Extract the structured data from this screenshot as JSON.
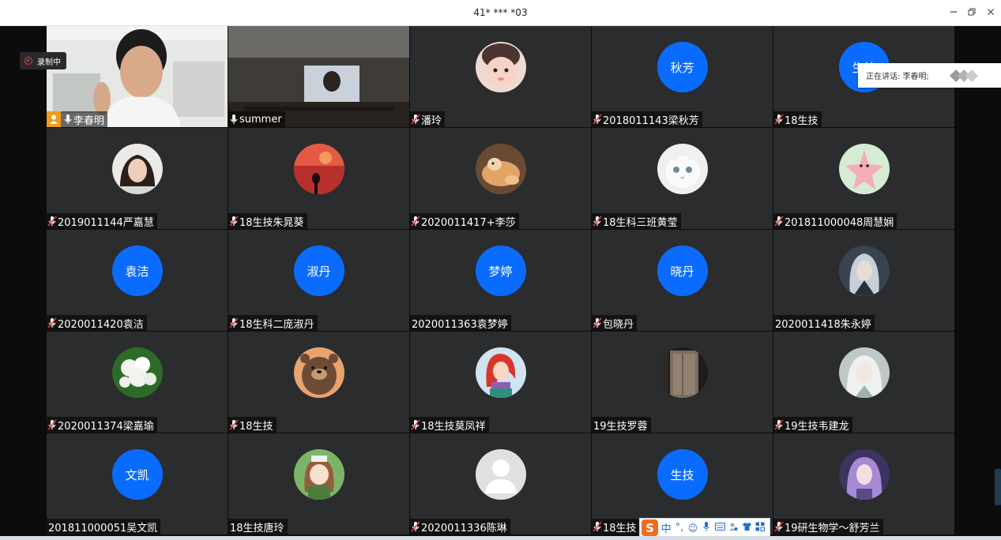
{
  "window": {
    "title": "41* *** *03",
    "buttons": [
      "minimize",
      "restore",
      "close"
    ]
  },
  "recording": {
    "label": "录制中",
    "icon": "record-icon"
  },
  "speaking": {
    "label": "正在讲话: 李春明;"
  },
  "colors": {
    "avatar_blue": "#0a6cff",
    "tile_bg": "#2b2c2e",
    "active_border": "#35c46b",
    "host_badge": "#f29a1a",
    "recording_red": "#e2403b"
  },
  "participants": [
    {
      "name": "李春明",
      "muted": false,
      "host": true,
      "kind": "video",
      "scene": "person",
      "active": true
    },
    {
      "name": "summer",
      "muted": false,
      "kind": "video",
      "scene": "classroom"
    },
    {
      "name": "潘玲",
      "muted": true,
      "kind": "photo",
      "scene": "baby"
    },
    {
      "name": "2018011143梁秋芳",
      "muted": true,
      "kind": "text",
      "avatar_text": "秋芳"
    },
    {
      "name": "18生技",
      "muted": true,
      "kind": "text",
      "avatar_text": "生技"
    },
    {
      "name": "2019011144严嘉慧",
      "muted": true,
      "kind": "photo",
      "scene": "girl"
    },
    {
      "name": "18生技朱晁葵",
      "muted": true,
      "kind": "photo",
      "scene": "sunset"
    },
    {
      "name": "2020011417+李莎",
      "muted": true,
      "kind": "photo",
      "scene": "dog"
    },
    {
      "name": "18生科三班黄莹",
      "muted": true,
      "kind": "photo",
      "scene": "cat"
    },
    {
      "name": "201811000048周慧娴",
      "muted": true,
      "kind": "photo",
      "scene": "starfish"
    },
    {
      "name": "2020011420袁洁",
      "muted": true,
      "kind": "text",
      "avatar_text": "袁洁"
    },
    {
      "name": "18生科二庞淑丹",
      "muted": true,
      "kind": "text",
      "avatar_text": "淑丹"
    },
    {
      "name": "2020011363袁梦婷",
      "muted": false,
      "kind": "text",
      "avatar_text": "梦婷",
      "no_mic": true
    },
    {
      "name": "包晓丹",
      "muted": true,
      "kind": "text",
      "avatar_text": "晓丹"
    },
    {
      "name": "2020011418朱永婷",
      "muted": false,
      "kind": "photo",
      "scene": "anime-silver",
      "no_mic": true
    },
    {
      "name": "2020011374梁嘉瑜",
      "muted": true,
      "kind": "photo",
      "scene": "flowers"
    },
    {
      "name": "18生技",
      "muted": true,
      "kind": "photo",
      "scene": "bear"
    },
    {
      "name": "18生技莫凤祥",
      "muted": true,
      "kind": "photo",
      "scene": "mermaid"
    },
    {
      "name": "19生技罗蓉",
      "muted": false,
      "kind": "photo",
      "scene": "door",
      "no_mic": true
    },
    {
      "name": "19生技韦建龙",
      "muted": true,
      "kind": "photo",
      "scene": "anime-white"
    },
    {
      "name": "文凯",
      "muted": false,
      "kind": "text",
      "avatar_text": "文凯",
      "label": "201811000051吴文凯",
      "no_mic": true
    },
    {
      "name": "18生技唐玲",
      "muted": false,
      "kind": "photo",
      "scene": "anime-girl",
      "no_mic": true
    },
    {
      "name": "2020011336陈琳",
      "muted": true,
      "kind": "photo",
      "scene": "default"
    },
    {
      "name": "18生技",
      "muted": true,
      "kind": "text",
      "avatar_text": "生技"
    },
    {
      "name": "19研生物学～舒芳兰",
      "muted": true,
      "kind": "photo",
      "scene": "anime-purple"
    }
  ],
  "ime": {
    "logo": "S",
    "items": [
      "中",
      "°,",
      "☺",
      "mic",
      "keyboard",
      "person",
      "shirt",
      "grid"
    ]
  }
}
